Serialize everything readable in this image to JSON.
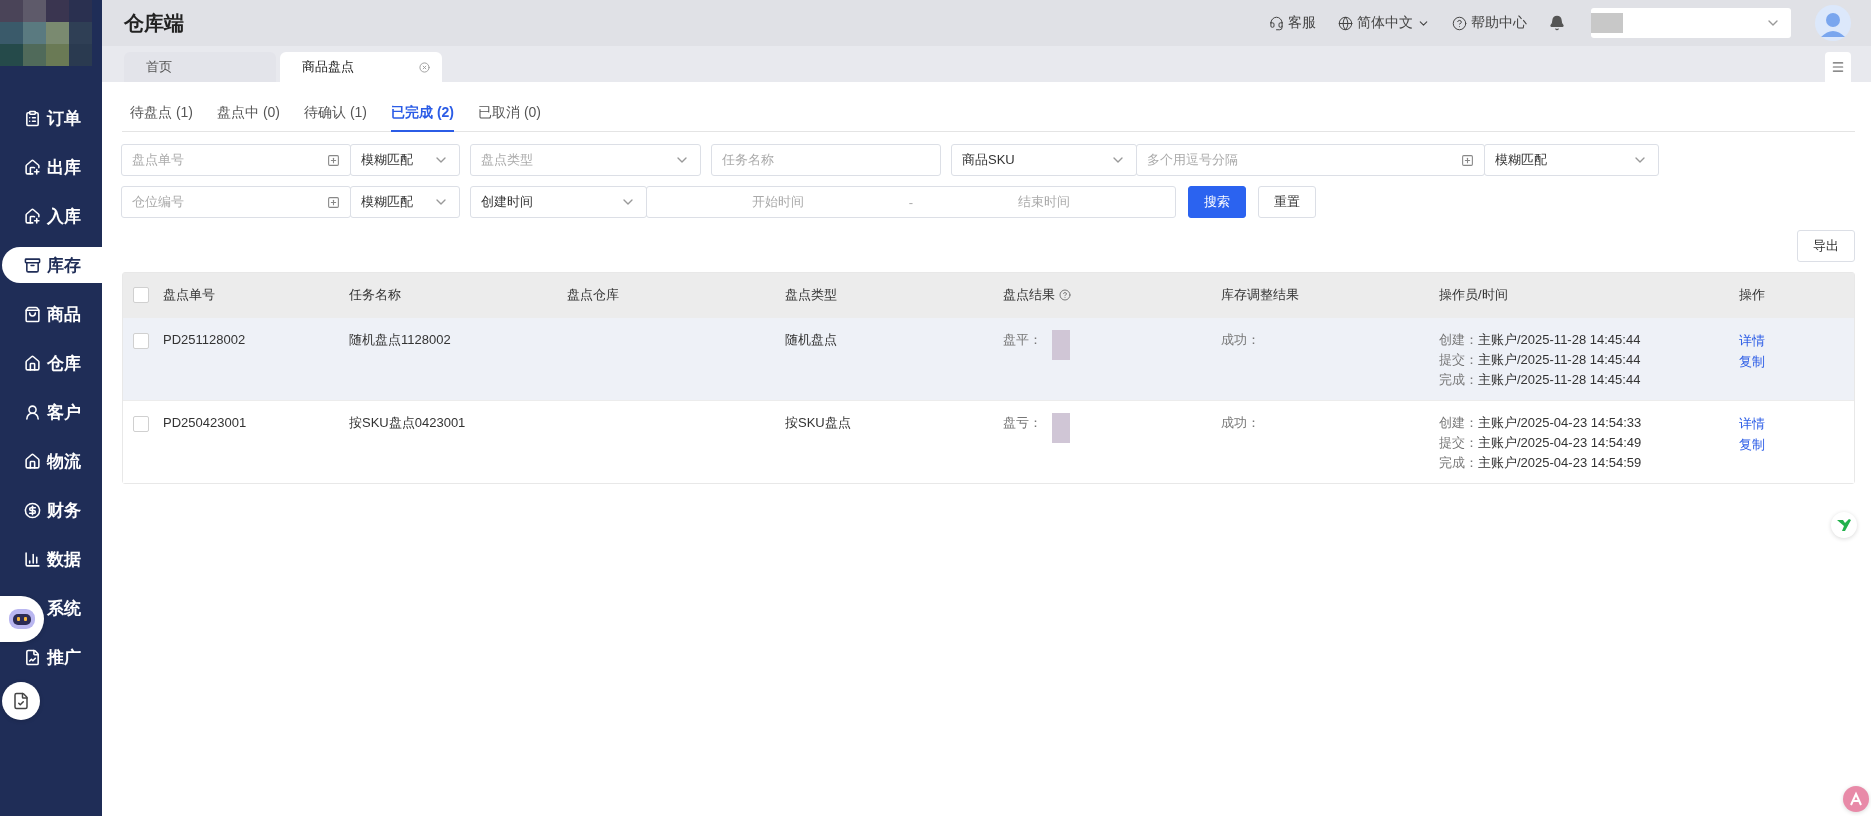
{
  "app": {
    "title": "仓库端"
  },
  "sidebar": {
    "items": [
      {
        "label": "订单",
        "selected": false
      },
      {
        "label": "出库",
        "selected": false
      },
      {
        "label": "入库",
        "selected": false
      },
      {
        "label": "库存",
        "selected": true
      },
      {
        "label": "商品",
        "selected": false
      },
      {
        "label": "仓库",
        "selected": false
      },
      {
        "label": "客户",
        "selected": false
      },
      {
        "label": "物流",
        "selected": false
      },
      {
        "label": "财务",
        "selected": false
      },
      {
        "label": "数据",
        "selected": false
      },
      {
        "label": "系统",
        "selected": false
      },
      {
        "label": "推广",
        "selected": false
      }
    ]
  },
  "header": {
    "links": [
      {
        "label": "客服",
        "dropdown": false
      },
      {
        "label": "简体中文",
        "dropdown": true
      },
      {
        "label": "帮助中心",
        "dropdown": false
      }
    ]
  },
  "page_tabs": [
    {
      "label": "首页",
      "selected": false,
      "closable": false
    },
    {
      "label": "商品盘点",
      "selected": true,
      "closable": true
    }
  ],
  "status_tabs": [
    {
      "label": "待盘点 (1)",
      "selected": false
    },
    {
      "label": "盘点中 (0)",
      "selected": false
    },
    {
      "label": "待确认 (1)",
      "selected": false
    },
    {
      "label": "已完成 (2)",
      "selected": true
    },
    {
      "label": "已取消 (0)",
      "selected": false
    }
  ],
  "filters": [
    [
      {
        "kind": "input",
        "placeholder": "盘点单号"
      },
      {
        "kind": "select",
        "value": "模糊匹配"
      },
      {
        "kind": "select",
        "placeholder": "盘点类型"
      },
      {
        "kind": "input_plain",
        "placeholder": "任务名称"
      },
      {
        "kind": "select",
        "value": "商品SKU"
      },
      {
        "kind": "input",
        "placeholder": "多个用逗号分隔"
      },
      {
        "kind": "select",
        "value": "模糊匹配"
      }
    ],
    [
      {
        "kind": "input",
        "placeholder": "仓位编号"
      },
      {
        "kind": "select",
        "value": "模糊匹配"
      },
      {
        "kind": "select",
        "value": "创建时间"
      },
      {
        "kind": "date_range",
        "start": "开始时间",
        "separator": "-",
        "end": "结束时间"
      },
      {
        "kind": "primary_button",
        "label": "搜索"
      },
      {
        "kind": "button",
        "label": "重置"
      }
    ]
  ],
  "export_button": "导出",
  "table": {
    "select_all": {
      "checked": false
    },
    "columns": [
      {
        "label": "盘点单号",
        "help": false
      },
      {
        "label": "任务名称",
        "help": false
      },
      {
        "label": "盘点仓库",
        "help": false
      },
      {
        "label": "盘点类型",
        "help": false
      },
      {
        "label": "盘点结果",
        "help": true
      },
      {
        "label": "库存调整结果",
        "help": false
      },
      {
        "label": "操作员/时间",
        "help": false
      },
      {
        "label": "操作",
        "help": false
      }
    ],
    "rows": [
      {
        "checked": false,
        "hovered": true,
        "id": "PD251128002",
        "task": "随机盘点1128002",
        "type": "随机盘点",
        "result": "盘平：",
        "adjust": "成功：",
        "ops": [
          {
            "label": "创建：",
            "value": "主账户/2025-11-28 14:45:44"
          },
          {
            "label": "提交：",
            "value": "主账户/2025-11-28 14:45:44"
          },
          {
            "label": "完成：",
            "value": "主账户/2025-11-28 14:45:44"
          }
        ],
        "actions": [
          "详情",
          "复制"
        ]
      },
      {
        "checked": false,
        "hovered": false,
        "id": "PD250423001",
        "task": "按SKU盘点0423001",
        "type": "按SKU盘点",
        "result": "盘亏：",
        "adjust": "成功：",
        "ops": [
          {
            "label": "创建：",
            "value": "主账户/2025-04-23 14:54:33"
          },
          {
            "label": "提交：",
            "value": "主账户/2025-04-23 14:54:49"
          },
          {
            "label": "完成：",
            "value": "主账户/2025-04-23 14:54:59"
          }
        ],
        "actions": [
          "详情",
          "复制"
        ]
      }
    ]
  }
}
